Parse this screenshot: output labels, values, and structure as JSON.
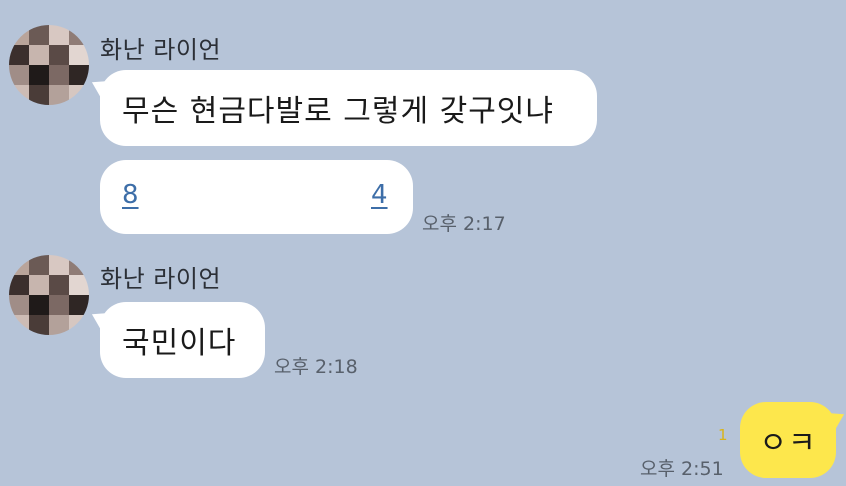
{
  "colors": {
    "background": "#b6c4d8",
    "incoming_bubble": "#ffffff",
    "outgoing_bubble": "#fde74c",
    "link": "#3d6ea8",
    "unread_count": "#d9b41a"
  },
  "chat": {
    "messages": [
      {
        "sender": "화난 라이언",
        "avatar_icon": "pixelated-avatar-icon",
        "lines": [
          {
            "text": "무슨 현금다발로 그렇게 갖구잇냐"
          },
          {
            "links": [
              "8",
              "4"
            ]
          }
        ],
        "time": "오후 2:17"
      },
      {
        "sender": "화난 라이언",
        "avatar_icon": "pixelated-avatar-icon",
        "lines": [
          {
            "text": "국민이다"
          }
        ],
        "time": "오후 2:18"
      },
      {
        "sender": "me",
        "text": "ㅇㅋ",
        "unread_count": "1",
        "time": "오후 2:51"
      }
    ]
  }
}
